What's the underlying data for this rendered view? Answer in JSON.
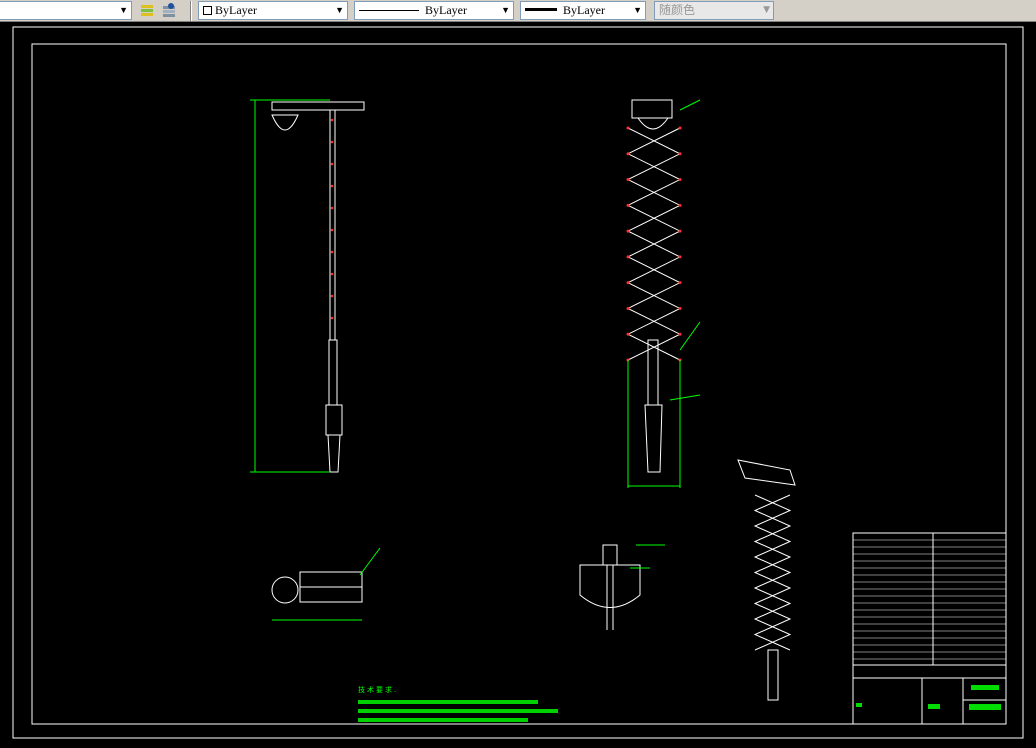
{
  "toolbar": {
    "color_combo": "ByLayer",
    "linetype_combo": "ByLayer",
    "lineweight_combo": "ByLayer",
    "plotstyle_combo": "随颜色",
    "icons": [
      "layer-previous-icon",
      "layer-state-icon"
    ]
  },
  "drawing": {
    "notes_heading": "技术要求.",
    "colors": {
      "background": "#000000",
      "lines": "#ffffff",
      "dimensions": "#00ff00",
      "points": "#ff0000",
      "border": "#ffffff"
    }
  }
}
